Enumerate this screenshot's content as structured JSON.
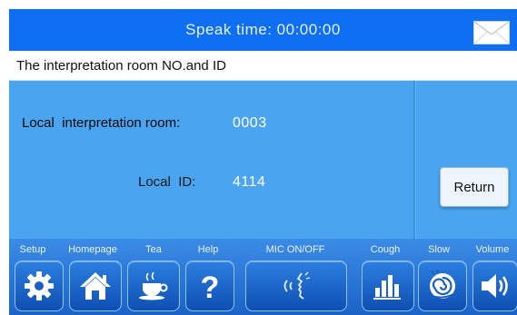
{
  "header": {
    "speak_label": "Speak time:",
    "speak_time": "00:00:00",
    "mail_icon": "envelope-icon"
  },
  "subheader": {
    "title": "The interpretation room NO.and ID"
  },
  "main": {
    "room_label": "Local  interpretation room:",
    "room_value": "0003",
    "id_label": "Local  ID:",
    "id_value": "4114",
    "return_label": "Return"
  },
  "toolbar": {
    "items": [
      {
        "label": "Setup",
        "icon": "gear-icon"
      },
      {
        "label": "Homepage",
        "icon": "home-icon"
      },
      {
        "label": "Tea",
        "icon": "tea-cup-icon"
      },
      {
        "label": "Help",
        "icon": "question-icon"
      },
      {
        "label": "MIC ON/OFF",
        "icon": "microphone-speaking-icon"
      },
      {
        "label": "Cough",
        "icon": "bars-icon"
      },
      {
        "label": "Slow",
        "icon": "snail-icon"
      },
      {
        "label": "Volume",
        "icon": "speaker-icon"
      }
    ]
  },
  "colors": {
    "header_blue": "#0f6ff2",
    "panel_blue": "#4aa4f0",
    "toolbar_blue": "#1c63c8"
  }
}
